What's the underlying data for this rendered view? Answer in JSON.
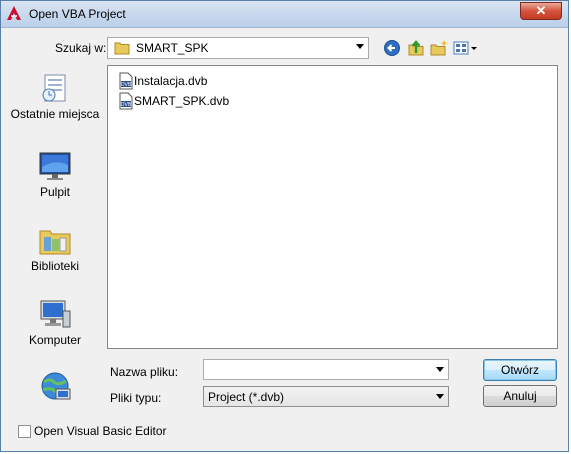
{
  "window": {
    "title": "Open VBA Project"
  },
  "lookin": {
    "label": "Szukaj w:",
    "value": "SMART_SPK"
  },
  "toolbar": {
    "back": "back-icon",
    "up": "up-folder-icon",
    "new_folder": "new-folder-icon",
    "views": "views-menu-icon"
  },
  "places": [
    {
      "label": "Ostatnie miejsca",
      "icon": "recent-places-icon"
    },
    {
      "label": "Pulpit",
      "icon": "desktop-icon"
    },
    {
      "label": "Biblioteki",
      "icon": "libraries-icon"
    },
    {
      "label": "Komputer",
      "icon": "computer-icon"
    },
    {
      "label": "",
      "icon": "network-icon"
    }
  ],
  "files": [
    {
      "name": "Instalacja.dvb",
      "icon": "dvb-file-icon"
    },
    {
      "name": "SMART_SPK.dvb",
      "icon": "dvb-file-icon"
    }
  ],
  "filename": {
    "label": "Nazwa pliku:",
    "value": ""
  },
  "filetype": {
    "label": "Pliki typu:",
    "value": "Project (*.dvb)"
  },
  "buttons": {
    "open": "Otwórz",
    "cancel": "Anuluj"
  },
  "options": {
    "open_editor_label": "Open Visual Basic Editor",
    "open_editor_checked": false
  },
  "colors": {
    "accent": "#3c7fb1",
    "title_bar": "#c9d9ee",
    "close": "#c23a24"
  }
}
